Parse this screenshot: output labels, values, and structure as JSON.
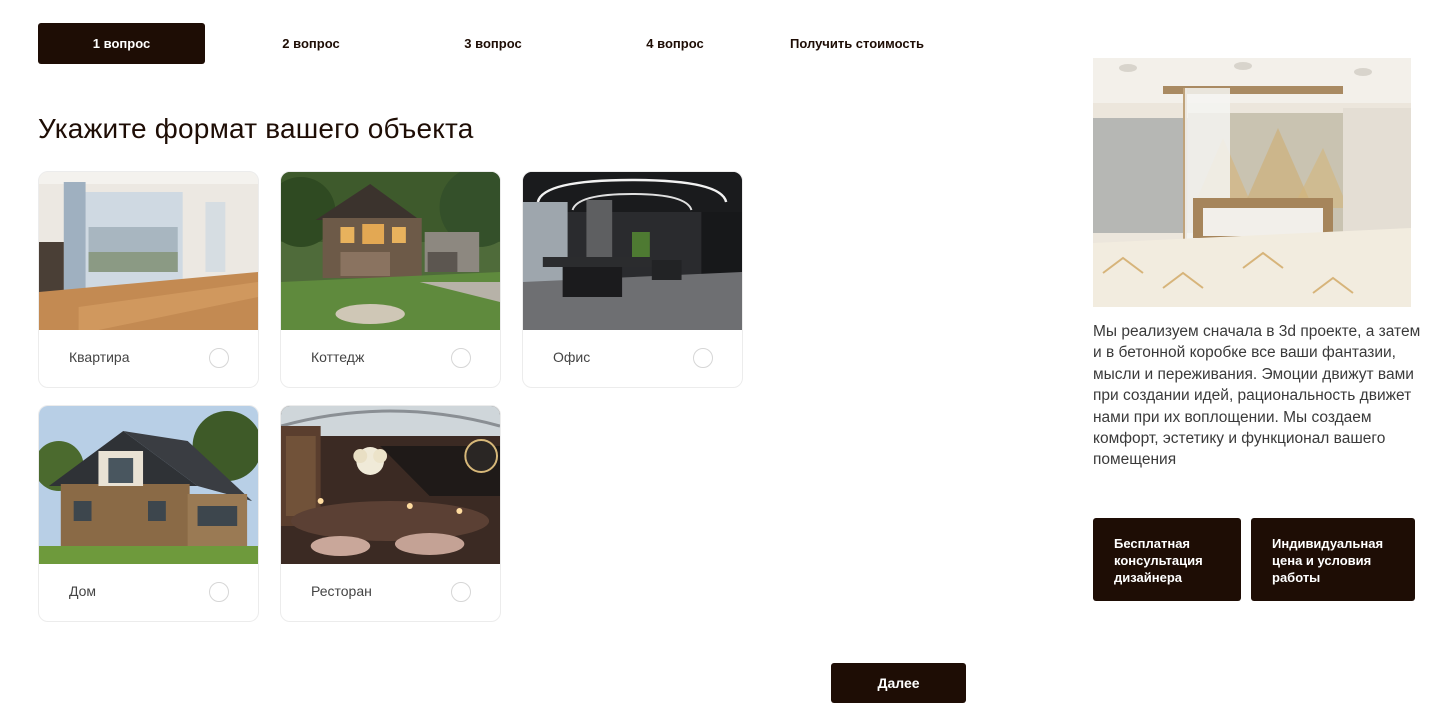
{
  "steps": [
    {
      "label": "1 вопрос",
      "active": true
    },
    {
      "label": "2 вопрос",
      "active": false
    },
    {
      "label": "3 вопрос",
      "active": false
    },
    {
      "label": "4 вопрос",
      "active": false
    },
    {
      "label": "Получить стоимость",
      "active": false
    }
  ],
  "question": "Укажите формат вашего объекта",
  "options": [
    {
      "label": "Квартира",
      "selected": false
    },
    {
      "label": "Коттедж",
      "selected": false
    },
    {
      "label": "Офис",
      "selected": false
    },
    {
      "label": "Дом",
      "selected": false
    },
    {
      "label": "Ресторан",
      "selected": false
    }
  ],
  "sidebar": {
    "description": "Мы реализуем сначала в 3d проекте, а затем и в бетонной коробке все ваши фантазии, мысли и переживания. Эмоции движут вами при создании идей, рациональность движет нами при их воплощении. Мы создаем комфорт, эстетику и функционал вашего помещения",
    "button_consult": "Бесплатная консультация дизайнера",
    "button_price": "Индивидуальная цена и условия работы"
  },
  "next_label": "Далее",
  "colors": {
    "accent": "#1e0d05",
    "text": "#1e0d05",
    "muted": "#444444",
    "border": "#ececec"
  }
}
